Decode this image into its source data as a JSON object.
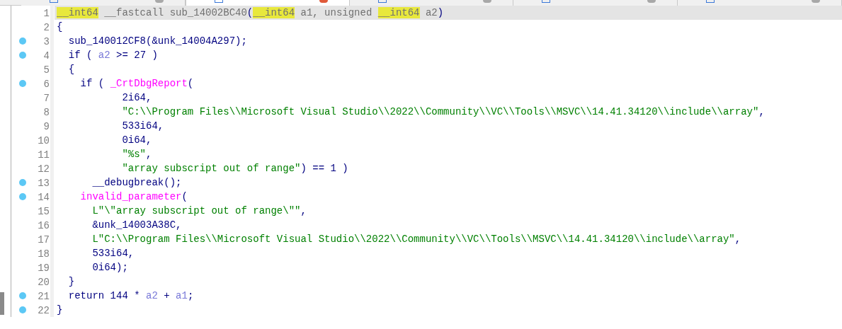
{
  "tabs": [
    {
      "selected": false
    },
    {
      "selected": true
    },
    {
      "selected": false
    },
    {
      "selected": false
    },
    {
      "selected": false
    }
  ],
  "lines": [
    {
      "number": "1",
      "breakpoint": false,
      "current": true,
      "tokens": [
        {
          "kind": "type",
          "text": "__int64"
        },
        {
          "kind": "decl",
          "text": " __fastcall sub_14002BC40"
        },
        {
          "kind": "plain",
          "text": "("
        },
        {
          "kind": "type",
          "text": "__int64"
        },
        {
          "kind": "decl",
          "text": " a1, unsigned "
        },
        {
          "kind": "type",
          "text": "__int64"
        },
        {
          "kind": "decl",
          "text": " a2"
        },
        {
          "kind": "plain",
          "text": ")"
        }
      ]
    },
    {
      "number": "2",
      "breakpoint": false,
      "current": false,
      "tokens": [
        {
          "kind": "plain",
          "text": "{"
        }
      ]
    },
    {
      "number": "3",
      "breakpoint": true,
      "current": false,
      "tokens": [
        {
          "kind": "plain",
          "text": "  sub_140012CF8(&unk_14004A297);"
        }
      ]
    },
    {
      "number": "4",
      "breakpoint": true,
      "current": false,
      "tokens": [
        {
          "kind": "plain",
          "text": "  if ( "
        },
        {
          "kind": "var",
          "text": "a2"
        },
        {
          "kind": "plain",
          "text": " >= 27 )"
        }
      ]
    },
    {
      "number": "5",
      "breakpoint": false,
      "current": false,
      "tokens": [
        {
          "kind": "plain",
          "text": "  {"
        }
      ]
    },
    {
      "number": "6",
      "breakpoint": true,
      "current": false,
      "tokens": [
        {
          "kind": "plain",
          "text": "    if ( "
        },
        {
          "kind": "func",
          "text": "_CrtDbgReport"
        },
        {
          "kind": "plain",
          "text": "("
        }
      ]
    },
    {
      "number": "7",
      "breakpoint": false,
      "current": false,
      "tokens": [
        {
          "kind": "plain",
          "text": "           2i64,"
        }
      ]
    },
    {
      "number": "8",
      "breakpoint": false,
      "current": false,
      "tokens": [
        {
          "kind": "string",
          "text": "           \"C:\\\\Program Files\\\\Microsoft Visual Studio\\\\2022\\\\Community\\\\VC\\\\Tools\\\\MSVC\\\\14.41.34120\\\\include\\\\array\""
        },
        {
          "kind": "plain",
          "text": ","
        }
      ]
    },
    {
      "number": "9",
      "breakpoint": false,
      "current": false,
      "tokens": [
        {
          "kind": "plain",
          "text": "           533i64,"
        }
      ]
    },
    {
      "number": "10",
      "breakpoint": false,
      "current": false,
      "tokens": [
        {
          "kind": "plain",
          "text": "           0i64,"
        }
      ]
    },
    {
      "number": "11",
      "breakpoint": false,
      "current": false,
      "tokens": [
        {
          "kind": "string",
          "text": "           \"%s\""
        },
        {
          "kind": "plain",
          "text": ","
        }
      ]
    },
    {
      "number": "12",
      "breakpoint": false,
      "current": false,
      "tokens": [
        {
          "kind": "string",
          "text": "           \"array subscript out of range\""
        },
        {
          "kind": "plain",
          "text": ") == 1 )"
        }
      ]
    },
    {
      "number": "13",
      "breakpoint": true,
      "current": false,
      "tokens": [
        {
          "kind": "plain",
          "text": "      __debugbreak();"
        }
      ]
    },
    {
      "number": "14",
      "breakpoint": true,
      "current": false,
      "tokens": [
        {
          "kind": "func",
          "text": "    invalid_parameter"
        },
        {
          "kind": "plain",
          "text": "("
        }
      ]
    },
    {
      "number": "15",
      "breakpoint": false,
      "current": false,
      "tokens": [
        {
          "kind": "string",
          "text": "      L\"\\\"array subscript out of range\\\"\""
        },
        {
          "kind": "plain",
          "text": ","
        }
      ]
    },
    {
      "number": "16",
      "breakpoint": false,
      "current": false,
      "tokens": [
        {
          "kind": "plain",
          "text": "      &unk_14003A38C,"
        }
      ]
    },
    {
      "number": "17",
      "breakpoint": false,
      "current": false,
      "tokens": [
        {
          "kind": "string",
          "text": "      L\"C:\\\\Program Files\\\\Microsoft Visual Studio\\\\2022\\\\Community\\\\VC\\\\Tools\\\\MSVC\\\\14.41.34120\\\\include\\\\array\""
        },
        {
          "kind": "plain",
          "text": ","
        }
      ]
    },
    {
      "number": "18",
      "breakpoint": false,
      "current": false,
      "tokens": [
        {
          "kind": "plain",
          "text": "      533i64,"
        }
      ]
    },
    {
      "number": "19",
      "breakpoint": false,
      "current": false,
      "tokens": [
        {
          "kind": "plain",
          "text": "      0i64);"
        }
      ]
    },
    {
      "number": "20",
      "breakpoint": false,
      "current": false,
      "tokens": [
        {
          "kind": "plain",
          "text": "  }"
        }
      ]
    },
    {
      "number": "21",
      "breakpoint": true,
      "current": false,
      "tokens": [
        {
          "kind": "plain",
          "text": "  return 144 * "
        },
        {
          "kind": "var",
          "text": "a2"
        },
        {
          "kind": "plain",
          "text": " + "
        },
        {
          "kind": "var",
          "text": "a1"
        },
        {
          "kind": "plain",
          "text": ";"
        }
      ]
    },
    {
      "number": "22",
      "breakpoint": true,
      "current": false,
      "tokens": [
        {
          "kind": "plain",
          "text": "}"
        }
      ]
    }
  ]
}
